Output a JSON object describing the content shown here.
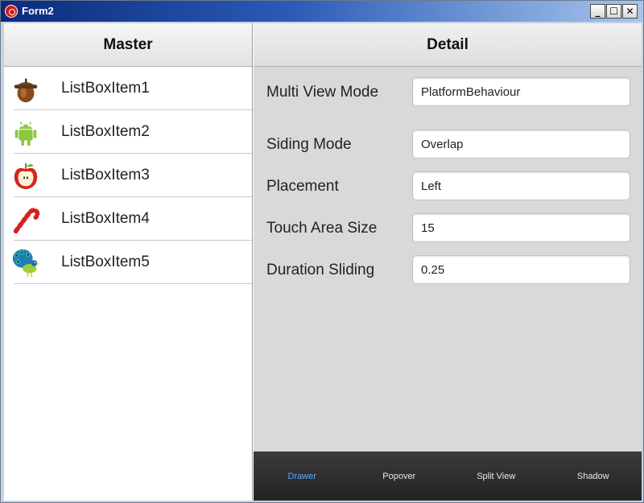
{
  "window": {
    "title": "Form2",
    "minimize_label": "_",
    "maximize_label": "☐",
    "close_label": "✕"
  },
  "master": {
    "header": "Master",
    "items": [
      {
        "label": "ListBoxItem1",
        "icon": "acorn-icon"
      },
      {
        "label": "ListBoxItem2",
        "icon": "android-icon"
      },
      {
        "label": "ListBoxItem3",
        "icon": "apple-icon"
      },
      {
        "label": "ListBoxItem4",
        "icon": "candy-cane-icon"
      },
      {
        "label": "ListBoxItem5",
        "icon": "peacock-icon"
      }
    ]
  },
  "detail": {
    "header": "Detail",
    "fields": [
      {
        "label": "Multi View Mode",
        "value": "PlatformBehaviour"
      },
      {
        "label": "Siding Mode",
        "value": "Overlap"
      },
      {
        "label": "Placement",
        "value": "Left"
      },
      {
        "label": "Touch Area Size",
        "value": "15"
      },
      {
        "label": "Duration Sliding",
        "value": "0.25"
      }
    ],
    "tabs": [
      {
        "label": "Drawer",
        "active": true
      },
      {
        "label": "Popover",
        "active": false
      },
      {
        "label": "Split View",
        "active": false
      },
      {
        "label": "Shadow",
        "active": false
      }
    ]
  },
  "colors": {
    "active_tab": "#5aa8ff",
    "titlebar": "#0b2a7a"
  }
}
